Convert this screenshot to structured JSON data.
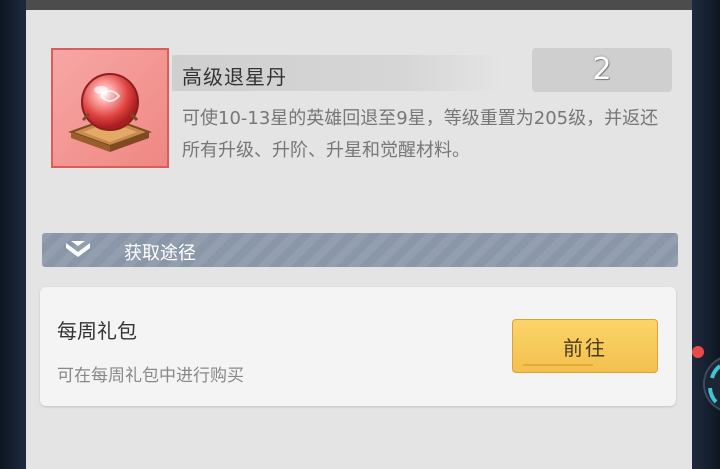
{
  "item": {
    "name": "高级退星丹",
    "count": "2",
    "description": "可使10-13星的英雄回退至9星，等级重置为205级，并返还所有升级、升阶、升星和觉醒材料。",
    "icon": "crystal-orb-icon"
  },
  "section": {
    "title": "获取途径",
    "icon": "double-chevron-down-icon"
  },
  "sources": [
    {
      "title": "每周礼包",
      "description": "可在每周礼包中进行购买",
      "button_label": "前往"
    }
  ],
  "colors": {
    "panel_bg": "#e4e4e4",
    "icon_frame": "#f09794",
    "section_header": "#8a97a8",
    "go_button": "#f7c95a",
    "notification_dot": "#e84a4a"
  }
}
